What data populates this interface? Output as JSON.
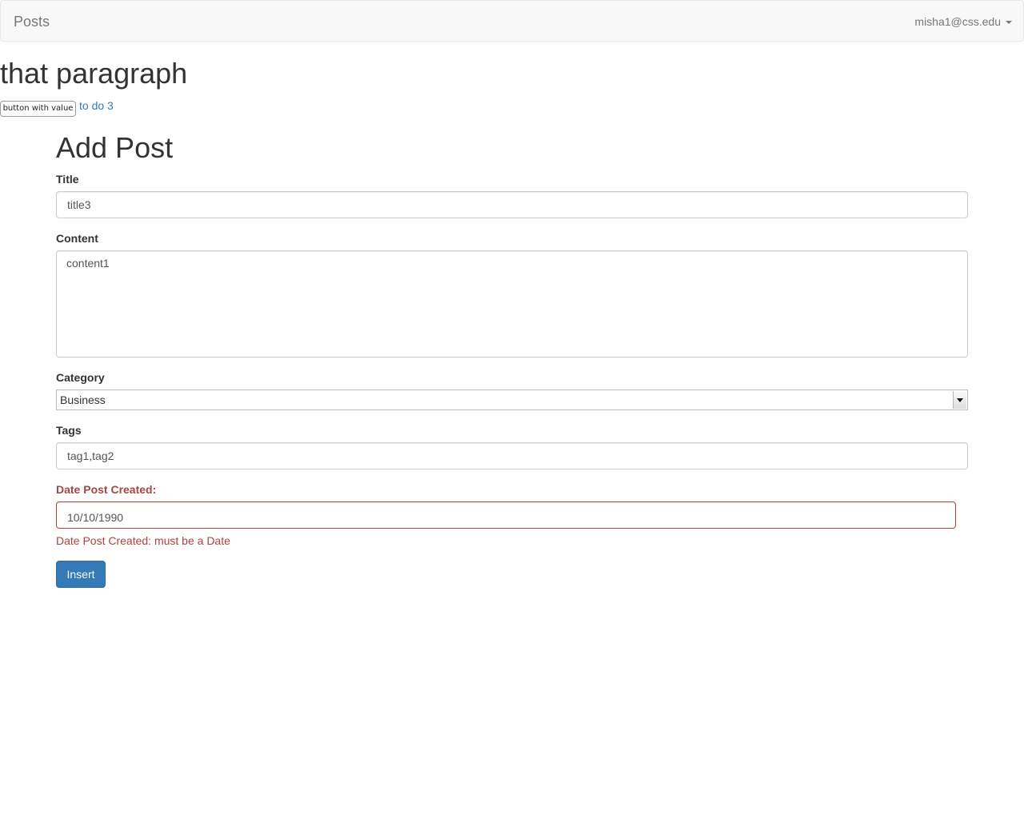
{
  "navbar": {
    "brand": "Posts",
    "user_email": "misha1@css.edu"
  },
  "header": {
    "heading": "that paragraph",
    "value_button_label": "button with value",
    "todo_link": "to do 3"
  },
  "form": {
    "title": "Add Post",
    "title_label": "Title",
    "title_value": "title3",
    "content_label": "Content",
    "content_value": "content1",
    "category_label": "Category",
    "category_selected": "Business",
    "tags_label": "Tags",
    "tags_value": "tag1,tag2",
    "date_label": "Date Post Created:",
    "date_value": "10/10/1990",
    "date_error": "Date Post Created: must be a Date",
    "submit_label": "Insert"
  },
  "colors": {
    "navbar_bg": "#f8f8f8",
    "link": "#337ab7",
    "primary_button": "#337ab7",
    "error": "#a94442"
  },
  "icons": {
    "user_menu": "caret-down-icon",
    "category_select": "dropdown-arrow-icon"
  }
}
